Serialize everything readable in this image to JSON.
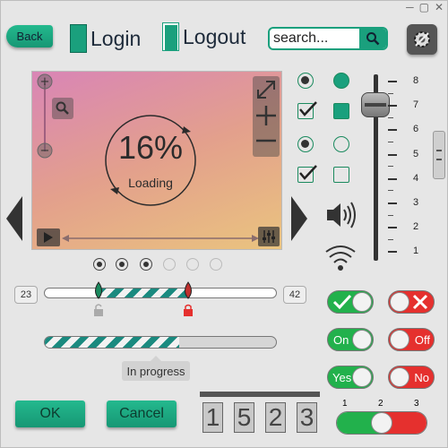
{
  "window": {
    "controls": [
      "─",
      "▢",
      "✕"
    ]
  },
  "header": {
    "back_label": "Back",
    "login_label": "Login",
    "logout_label": "Logout",
    "search_placeholder": "search...",
    "icons": [
      "search-icon",
      "settings-gear-icon"
    ]
  },
  "player": {
    "progress_text": "16%",
    "status_text": "Loading",
    "progress_value": 0.16,
    "icons": [
      "zoom-icon",
      "fullscreen-icon",
      "plus-icon",
      "minus-icon",
      "play-icon",
      "equalizer-icon",
      "prev-arrow-icon",
      "next-arrow-icon"
    ],
    "page_dots": [
      true,
      true,
      true,
      false,
      false,
      false
    ]
  },
  "range": {
    "min_label": "23",
    "max_label": "42",
    "low_value": 0.23,
    "high_value": 0.62
  },
  "progress": {
    "value": 0.58,
    "tooltip": "In progress"
  },
  "buttons": {
    "ok": "OK",
    "cancel": "Cancel"
  },
  "counter": {
    "digits": [
      "1",
      "5",
      "2",
      "3"
    ]
  },
  "vertical_slider": {
    "ticks": [
      "8",
      "7",
      "6",
      "5",
      "4",
      "3",
      "2",
      "1"
    ],
    "value": 7
  },
  "toggles": {
    "on_label": "On",
    "off_label": "Off",
    "yes_label": "Yes",
    "no_label": "No"
  },
  "three_switch": {
    "labels": [
      "1",
      "2",
      "3"
    ],
    "selected": "2"
  },
  "colors": {
    "accent": "#1aa07d",
    "on": "#22b14c",
    "off": "#e5302e"
  }
}
